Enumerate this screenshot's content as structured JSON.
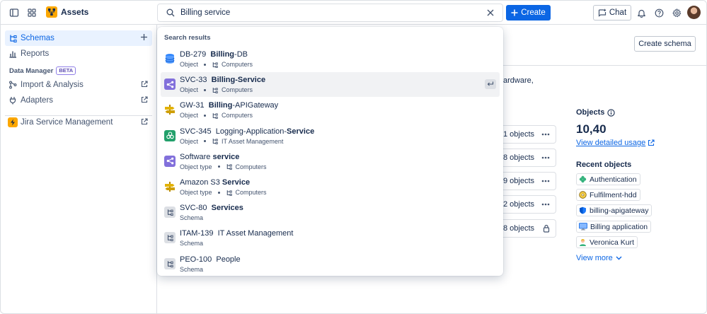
{
  "topbar": {
    "app_name": "Assets",
    "search_value": "Billing service",
    "create_label": "Create",
    "chat_label": "Chat"
  },
  "sidebar": {
    "items": [
      {
        "label": "Schemas"
      },
      {
        "label": "Reports"
      }
    ],
    "section_label": "Data Manager",
    "beta_label": "BETA",
    "dm_items": [
      {
        "label": "Import & Analysis"
      },
      {
        "label": "Adapters"
      }
    ],
    "app_item": {
      "label": "Jira Service Management"
    }
  },
  "main": {
    "create_schema_label": "Create schema",
    "description_fragment": "ardware,",
    "count_rows": [
      {
        "text": "1 objects",
        "icon": "more-icon"
      },
      {
        "text": "8 objects",
        "icon": "more-icon"
      },
      {
        "text": "9 objects",
        "icon": "more-icon"
      },
      {
        "text": "2 objects",
        "icon": "more-icon"
      },
      {
        "text": "8 objects",
        "icon": "lock-icon"
      }
    ],
    "objects_title": "Objects",
    "objects_count": "10,40",
    "view_usage_label": "View detailed usage",
    "recent_title": "Recent objects",
    "recent": [
      {
        "label": "Authentication",
        "icon": "clover-icon"
      },
      {
        "label": "Fulfilment-hdd",
        "icon": "disk-icon"
      },
      {
        "label": "billing-apigateway",
        "icon": "shield-icon"
      },
      {
        "label": "Billing application",
        "icon": "monitor-icon"
      },
      {
        "label": "Veronica Kurt",
        "icon": "person-icon"
      }
    ],
    "view_more_label": "View more"
  },
  "dropdown": {
    "header": "Search results",
    "results": [
      {
        "key": "DB-279",
        "pre": "",
        "bold": "Billing",
        "post": "-DB",
        "type": "Object",
        "schema": "Computers",
        "icon": "database-icon",
        "selected": false
      },
      {
        "key": "SVC-33",
        "pre": "",
        "bold": "Billing-Service",
        "post": "",
        "type": "Object",
        "schema": "Computers",
        "icon": "service-icon",
        "selected": true
      },
      {
        "key": "GW-31",
        "pre": "",
        "bold": "Billing",
        "post": "-APIGateway",
        "type": "Object",
        "schema": "Computers",
        "icon": "gateway-icon",
        "selected": false
      },
      {
        "key": "SVC-345",
        "pre": "Logging-Application-",
        "bold": "Service",
        "post": "",
        "type": "Object",
        "schema": "IT Asset Management",
        "icon": "app-icon",
        "selected": false
      },
      {
        "key": "",
        "pre": "Software ",
        "bold": "service",
        "post": "",
        "type": "Object type",
        "schema": "Computers",
        "icon": "service-icon",
        "selected": false
      },
      {
        "key": "",
        "pre": "Amazon S3 ",
        "bold": "Service",
        "post": "",
        "type": "Object type",
        "schema": "Computers",
        "icon": "gateway-icon",
        "selected": false
      },
      {
        "key": "SVC-80",
        "pre": "",
        "bold": "Services",
        "post": "",
        "type": "Schema",
        "schema": "",
        "icon": "schema-icon",
        "selected": false
      },
      {
        "key": "ITAM-139",
        "pre": "IT Asset Management",
        "bold": "",
        "post": "",
        "type": "Schema",
        "schema": "",
        "icon": "schema-icon",
        "selected": false
      },
      {
        "key": "PEO-100",
        "pre": "People",
        "bold": "",
        "post": "",
        "type": "Schema",
        "schema": "",
        "icon": "schema-icon",
        "selected": false
      }
    ]
  },
  "colors": {
    "accent": "#0c66e4",
    "brand": "#fca700",
    "selected_bg": "#f1f2f4"
  }
}
